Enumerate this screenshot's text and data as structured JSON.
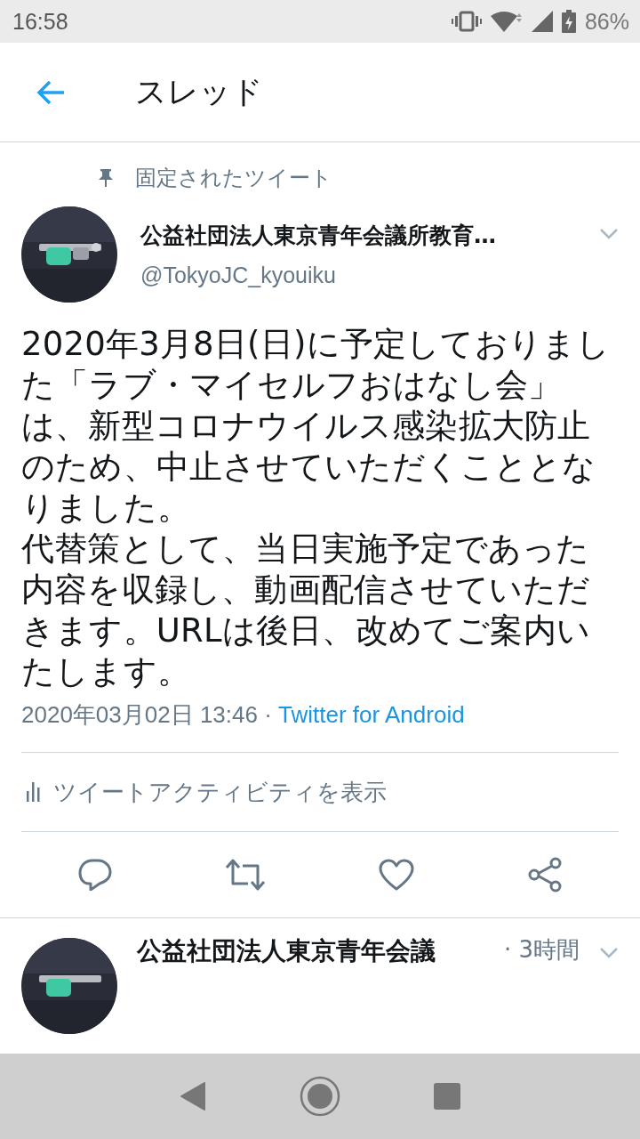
{
  "status_bar": {
    "time": "16:58",
    "battery": "86%"
  },
  "header": {
    "title": "スレッド"
  },
  "tweet": {
    "pinned_label": "固定されたツイート",
    "display_name": "公益社団法人東京青年会議所教育…",
    "handle": "@TokyoJC_kyouiku",
    "body": [
      "2020年3月8日(日)に予定しておりました「ラブ・マイセルフおはなし会」は、新型コロナウイルス感染拡大防止のため、中止させていただくこととなりました。",
      "代替策として、当日実施予定であった内容を収録し、動画配信させていただきます。URLは後日、改めてご案内いたします。"
    ],
    "timestamp": "2020年03月02日 13:46 · ",
    "source": "Twitter for Android",
    "activity_link": "ツイートアクティビティを表示"
  },
  "next_tweet": {
    "display_name": "公益社団法人東京青年会議",
    "time": "· 3時間"
  }
}
